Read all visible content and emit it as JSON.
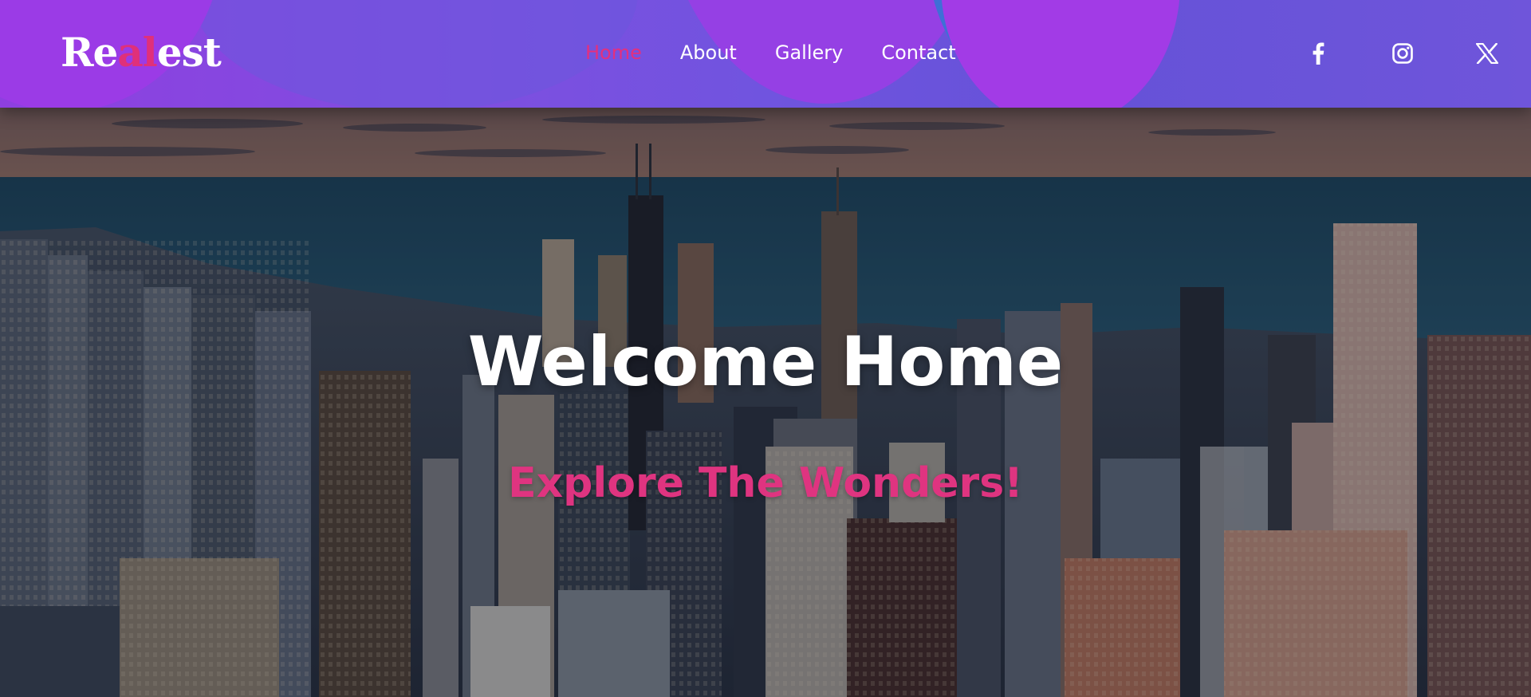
{
  "brand": {
    "prefix": "Re",
    "accent": "al",
    "suffix": "est",
    "accent_color": "#e0307a"
  },
  "nav": {
    "links": [
      {
        "label": "Home",
        "active": true
      },
      {
        "label": "About",
        "active": false
      },
      {
        "label": "Gallery",
        "active": false
      },
      {
        "label": "Contact",
        "active": false
      }
    ],
    "active_color": "#e3307e"
  },
  "social": [
    {
      "icon": "facebook-icon"
    },
    {
      "icon": "instagram-icon"
    },
    {
      "icon": "x-icon"
    }
  ],
  "hero": {
    "title": "Welcome Home",
    "subtitle": "Explore The Wonders!",
    "subtitle_color": "#df3480",
    "background": "city-skyline-photo"
  },
  "colors": {
    "navbar_gradient_start": "#8e3fe0",
    "navbar_gradient_end": "#6f55da"
  }
}
